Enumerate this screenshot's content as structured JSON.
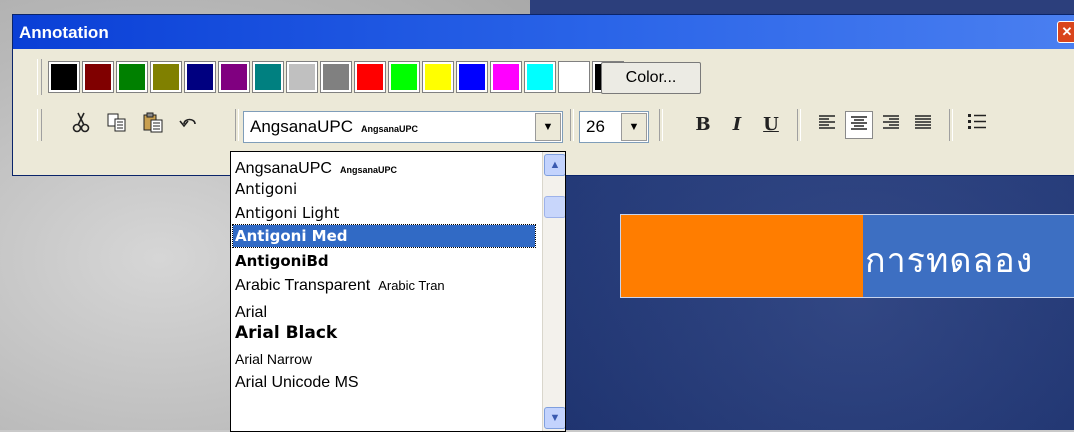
{
  "window": {
    "title": "Annotation",
    "close_symbol": "✕"
  },
  "palette": {
    "colors": [
      "#000000",
      "#800000",
      "#008000",
      "#808000",
      "#000080",
      "#800080",
      "#008080",
      "#c0c0c0",
      "#808080",
      "#ff0000",
      "#00ff00",
      "#ffff00",
      "#0000ff",
      "#ff00ff",
      "#00ffff",
      "#ffffff",
      "#000000"
    ],
    "color_button_label": "Color..."
  },
  "toolbar": {
    "cut_icon": "scissors-icon",
    "copy_icon": "copy-icon",
    "paste_icon": "paste-icon",
    "undo_icon": "undo-icon",
    "font_value": "AngsanaUPC",
    "font_preview": "AngsanaUPC",
    "size_value": "26",
    "bold_label": "B",
    "italic_label": "I",
    "underline_label": "U"
  },
  "font_list": {
    "selected_index": 3,
    "items": [
      {
        "name": "AngsanaUPC",
        "preview": "AngsanaUPC"
      },
      {
        "name": "Antigoni",
        "preview": ""
      },
      {
        "name": "Antigoni Light",
        "preview": ""
      },
      {
        "name": "Antigoni Med",
        "preview": ""
      },
      {
        "name": "AntigoniBd",
        "preview": ""
      },
      {
        "name": "Arabic Transparent",
        "preview": "Arabic Tran"
      },
      {
        "name": "Arial",
        "preview": ""
      },
      {
        "name": "Arial Black",
        "preview": ""
      },
      {
        "name": "Arial Narrow",
        "preview": ""
      },
      {
        "name": "Arial Unicode MS",
        "preview": ""
      }
    ]
  },
  "slide": {
    "text": "การทดลอง"
  }
}
